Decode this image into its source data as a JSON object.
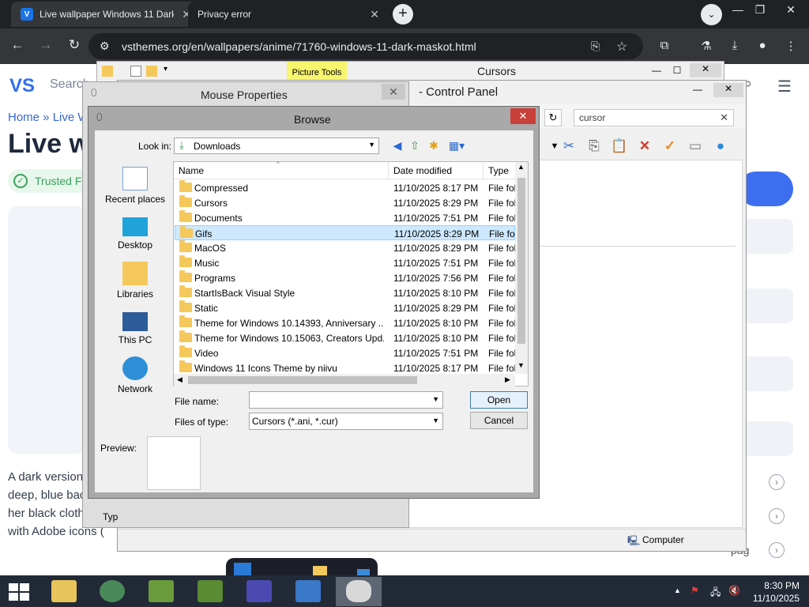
{
  "browser": {
    "tabs": [
      {
        "title": "Live wallpaper Windows 11 Dark",
        "close": "✕"
      },
      {
        "title": "Privacy error",
        "close": "✕"
      }
    ],
    "new_tab": "+",
    "url": "vsthemes.org/en/wallpapers/anime/71760-windows-11-dark-maskot.html",
    "window_controls": [
      "—",
      "❐",
      "✕"
    ]
  },
  "webpage": {
    "logo": "VS",
    "search_placeholder": "Search",
    "breadcrumb": "Home » Live W",
    "title": "Live w",
    "trusted": "Trusted Fi",
    "desc_lines": [
      "A dark version",
      "deep, blue bac",
      "her black clothe",
      "with Adobe icons ("
    ],
    "side_text": "pag"
  },
  "cursors_window": {
    "title": "Cursors",
    "context_tab": "Picture Tools"
  },
  "control_panel": {
    "title": "- Control Panel",
    "search_value": "cursor",
    "status": "Computer"
  },
  "mouse_properties": {
    "title": "Mouse Properties",
    "close": "✕",
    "partial_label": "Typ"
  },
  "browse": {
    "title": "Browse",
    "close": "✕",
    "look_in_label": "Look in:",
    "look_in_value": "Downloads",
    "places": [
      "Recent places",
      "Desktop",
      "Libraries",
      "This PC",
      "Network"
    ],
    "columns": {
      "name": "Name",
      "date": "Date modified",
      "type": "Type"
    },
    "files": [
      {
        "name": "Compressed",
        "date": "11/10/2025 8:17 PM",
        "type": "File folder"
      },
      {
        "name": "Cursors",
        "date": "11/10/2025 8:29 PM",
        "type": "File folder"
      },
      {
        "name": "Documents",
        "date": "11/10/2025 7:51 PM",
        "type": "File folder"
      },
      {
        "name": "Gifs",
        "date": "11/10/2025 8:29 PM",
        "type": "File folder"
      },
      {
        "name": "MacOS",
        "date": "11/10/2025 8:29 PM",
        "type": "File folder"
      },
      {
        "name": "Music",
        "date": "11/10/2025 7:51 PM",
        "type": "File folder"
      },
      {
        "name": "Programs",
        "date": "11/10/2025 7:56 PM",
        "type": "File folder"
      },
      {
        "name": "StartIsBack Visual Style",
        "date": "11/10/2025 8:10 PM",
        "type": "File folder"
      },
      {
        "name": "Static",
        "date": "11/10/2025 8:29 PM",
        "type": "File folder"
      },
      {
        "name": "Theme for Windows 10.14393, Anniversary ...",
        "date": "11/10/2025 8:10 PM",
        "type": "File folder"
      },
      {
        "name": "Theme for Windows 10.15063, Creators Upd...",
        "date": "11/10/2025 8:10 PM",
        "type": "File folder"
      },
      {
        "name": "Video",
        "date": "11/10/2025 7:51 PM",
        "type": "File folder"
      },
      {
        "name": "Windows 11 Icons Theme by niivu",
        "date": "11/10/2025 8:17 PM",
        "type": "File folder"
      }
    ],
    "selected_index": 3,
    "file_name_label": "File name:",
    "file_name_value": "",
    "files_of_type_label": "Files of type:",
    "files_of_type_value": "Cursors (*.ani, *.cur)",
    "open_button": "Open",
    "cancel_button": "Cancel",
    "preview_label": "Preview:"
  },
  "taskbar": {
    "time": "8:30 PM",
    "date": "11/10/2025"
  }
}
